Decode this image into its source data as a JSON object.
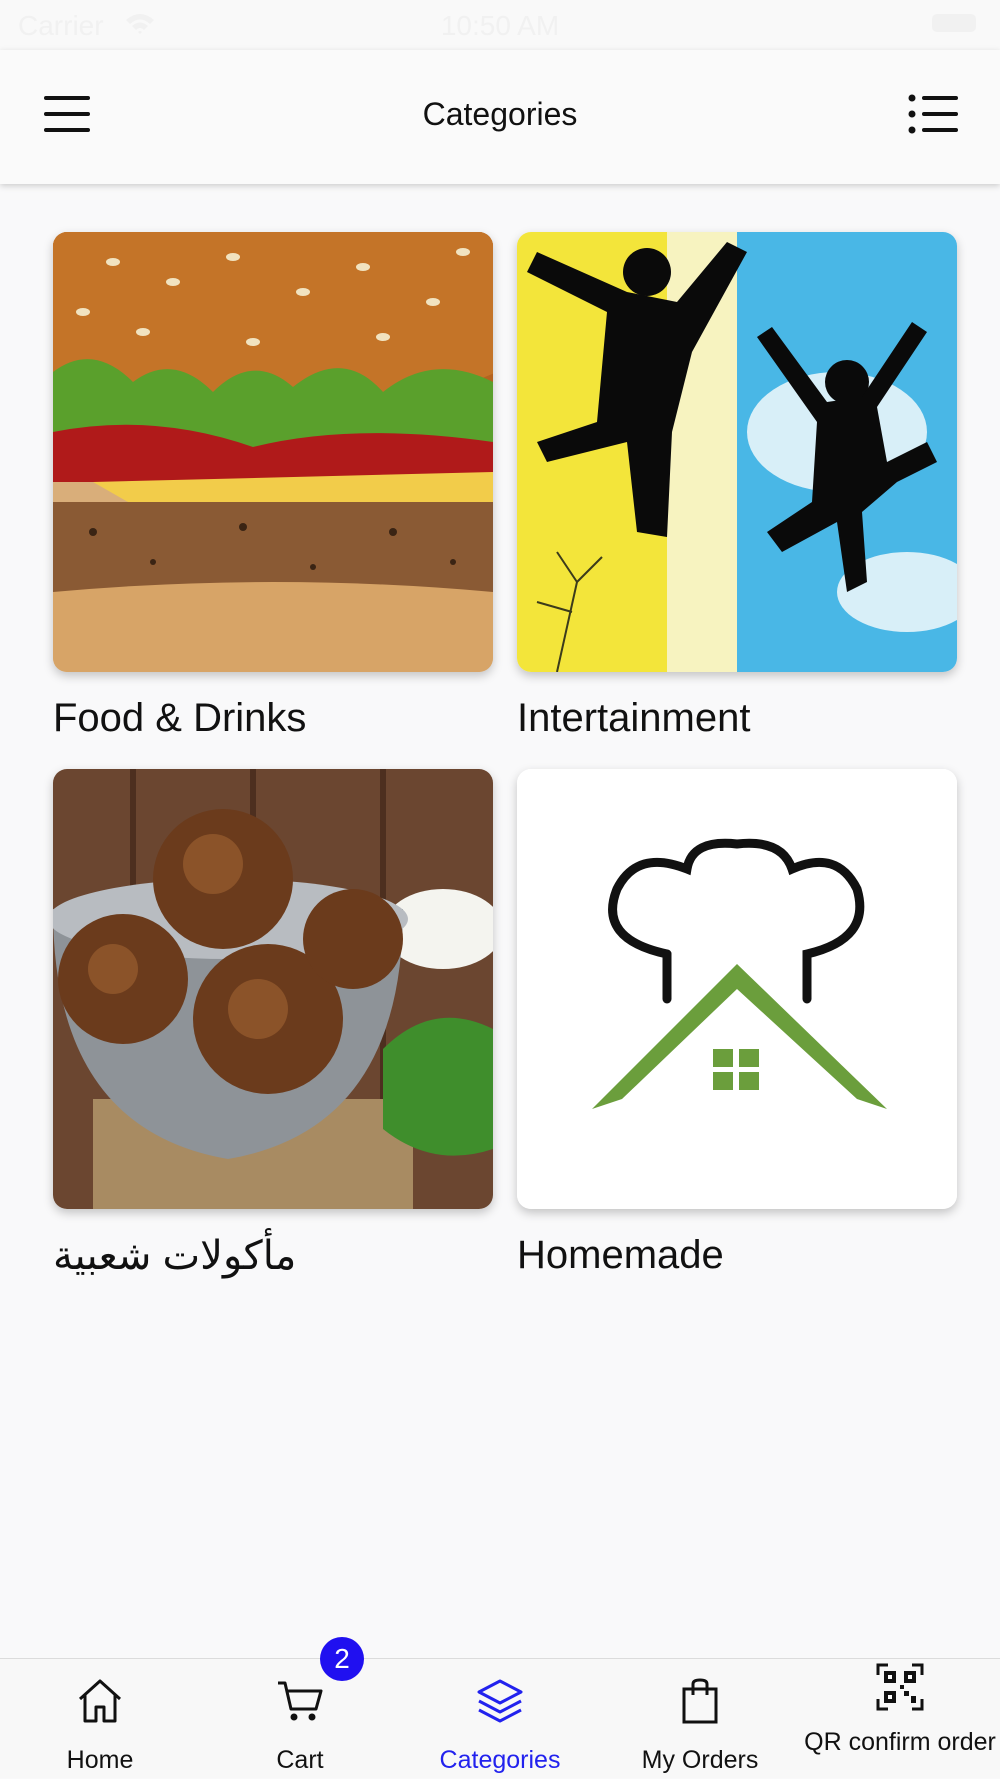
{
  "status_bar": {
    "carrier": "Carrier",
    "time": "10:50 AM"
  },
  "header": {
    "title": "Categories"
  },
  "categories": [
    {
      "label": "Food & Drinks"
    },
    {
      "label": "Intertainment"
    },
    {
      "label": "مأكولات شعبية"
    },
    {
      "label": "Homemade"
    }
  ],
  "tabs": [
    {
      "label": "Home",
      "icon": "home-icon"
    },
    {
      "label": "Cart",
      "icon": "cart-icon",
      "badge": "2"
    },
    {
      "label": "Categories",
      "icon": "layers-icon",
      "active": true
    },
    {
      "label": "My Orders",
      "icon": "shopping-bag-icon"
    },
    {
      "label": "QR confirm order",
      "icon": "qr-code-icon"
    }
  ],
  "colors": {
    "active_tab": "#2222ee",
    "badge": "#2010f0",
    "homemade_green": "#6b9e3c"
  }
}
